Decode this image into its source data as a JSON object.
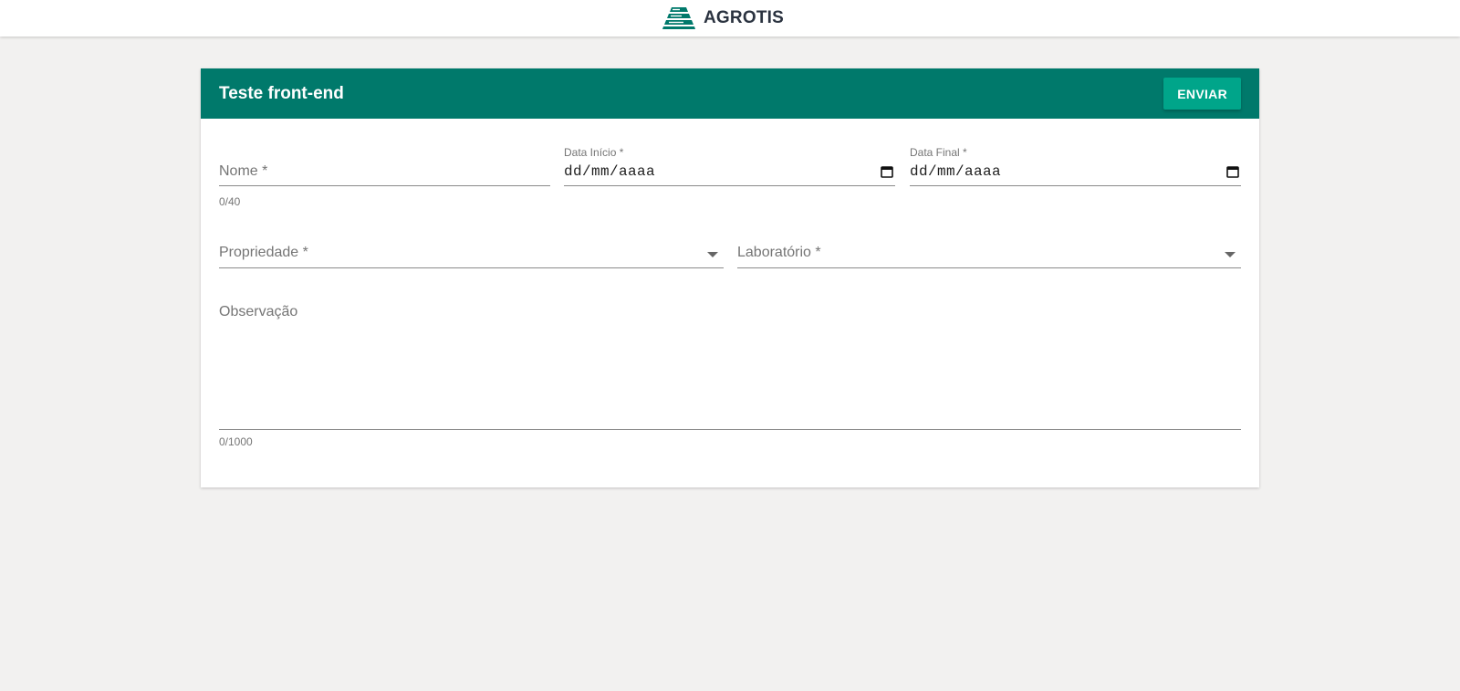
{
  "header": {
    "brand_name": "AGROTIS",
    "logo_icon": "agrotis-logo-icon",
    "brand_color": "#00796b"
  },
  "card": {
    "title": "Teste front-end",
    "submit_label": "ENVIAR",
    "header_color": "#00796b",
    "button_color": "#00a58a"
  },
  "form": {
    "nome": {
      "placeholder": "Nome *",
      "counter": "0/40"
    },
    "data_inicio": {
      "label": "Data Início *",
      "value": "dd/mm/aaaa",
      "icon": "calendar-icon"
    },
    "data_final": {
      "label": "Data Final *",
      "value": "dd/mm/aaaa",
      "icon": "calendar-icon"
    },
    "propriedade": {
      "placeholder": "Propriedade *",
      "icon": "chevron-down-icon"
    },
    "laboratorio": {
      "placeholder": "Laboratório *",
      "icon": "chevron-down-icon"
    },
    "observacao": {
      "placeholder": "Observação",
      "counter": "0/1000"
    }
  }
}
